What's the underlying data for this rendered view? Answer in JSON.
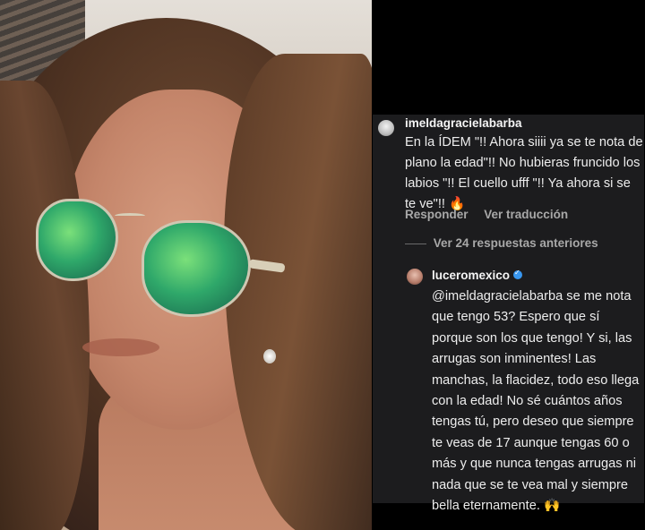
{
  "comment1": {
    "username": "imeldagracielabarba",
    "text": "En la ÍDEM \"!! Ahora siiii ya se te nota de plano la edad\"!! No hubieras fruncido los labios \"!! El cuello ufff \"!! Ya ahora si se te ve\"!! 🔥",
    "reply_label": "Responder",
    "translate_label": "Ver traducción"
  },
  "view_replies": "Ver 24 respuestas anteriores",
  "comment2": {
    "username": "luceromexico",
    "text": "@imeldagracielabarba se me nota que tengo 53? Espero que sí porque son los que tengo! Y si, las arrugas son inminentes! Las manchas, la flacidez, todo eso llega con la edad! No sé cuántos años tengas tú, pero deseo que siempre te veas de 17 aunque tengas 60 o más y que nunca tengas arrugas ni nada que se te vea mal y siempre bella eternamente. 🙌"
  },
  "colors": {
    "panel_bg": "#1c1c1e",
    "text": "#ededed",
    "muted": "#a8a8a8",
    "verified": "#3897f0"
  }
}
